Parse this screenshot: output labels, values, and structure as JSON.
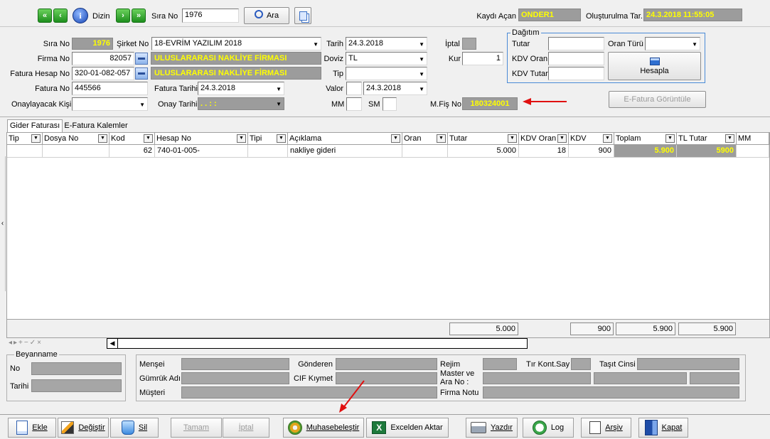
{
  "toolbar": {
    "nav_first": "«",
    "nav_prev": "‹",
    "info_label": "Dizin",
    "nav_next": "›",
    "nav_last": "»",
    "sira_label": "Sıra No",
    "sira_value": "1976",
    "search_label": "Ara",
    "kaydi_acan_label": "Kaydı Açan",
    "kaydi_acan_value": "ONDER1",
    "olusturma_label": "Oluşturulma Tar.",
    "olusturma_value": "24.3.2018 11:55:05"
  },
  "form": {
    "sira_no_label": "Sıra No",
    "sira_no_value": "1976",
    "sirket_label": "Şirket No",
    "sirket_value": "18-EVRİM YAZILIM 2018",
    "tarih_label": "Tarih",
    "tarih_value": "24.3.2018",
    "iptal_label": "İptal",
    "firma_label": "Firma No",
    "firma_value": "82057",
    "firma_name": "ULUSLARARASI NAKLİYE FİRMASI",
    "doviz_label": "Doviz",
    "doviz_value": "TL",
    "kur_label": "Kur",
    "kur_value": "1",
    "fatura_hesap_label": "Fatura Hesap No",
    "fatura_hesap_value": "320-01-082-057",
    "fatura_hesap_name": "ULUSLARARASI NAKLİYE FİRMASI",
    "tip_label": "Tip",
    "tip_value": "",
    "fatura_no_label": "Fatura No",
    "fatura_no_value": "445566",
    "fatura_tarihi_label": "Fatura Tarihi",
    "fatura_tarihi_value": "24.3.2018",
    "valor_label": "Valor",
    "valor_value": "24.3.2018",
    "onaylayacak_label": "Onaylayacak Kişi",
    "onay_tarihi_label": "Onay Tarihi",
    "onay_tarihi_value": ".   .        :   :",
    "mm_label": "MM",
    "sm_label": "SM",
    "mfis_label": "M.Fiş No",
    "mfis_value": "180324001"
  },
  "dagitim": {
    "title": "Dağıtım",
    "tutar_label": "Tutar",
    "oran_turu_label": "Oran Türü",
    "kdv_oran_label": "KDV Oran",
    "kdv_tutar_label": "KDV Tutar",
    "hesapla_label": "Hesapla",
    "efatura_btn": "E-Fatura Görüntüle"
  },
  "tabs": [
    "Gider Faturası",
    "E-Fatura Kalemler"
  ],
  "grid": {
    "columns": [
      "Tip",
      "Dosya No",
      "Kod",
      "Hesap No",
      "Tipi",
      "Açıklama",
      "Oran",
      "Tutar",
      "KDV Oran",
      "KDV",
      "Toplam",
      "TL Tutar",
      "MM"
    ],
    "row": {
      "tip": "",
      "dosya_no": "",
      "kod": "62",
      "hesap_no": "740-01-005-",
      "tipi": "",
      "aciklama": "nakliye gideri",
      "oran": "",
      "tutar": "5.000",
      "kdv_oran": "18",
      "kdv": "900",
      "toplam": "5.900",
      "tl_tutar": "5900"
    },
    "totals": {
      "tutar": "5.000",
      "kdv": "900",
      "toplam": "5.900",
      "tl_tutar": "5.900"
    }
  },
  "beyanname": {
    "title": "Beyanname",
    "no_label": "No",
    "tarihi_label": "Tarihi"
  },
  "detail": {
    "mensei_label": "Menşei",
    "gonderen_label": "Gönderen",
    "rejim_label": "Rejim",
    "tir_label": "Tır Kont.Say",
    "tasit_label": "Taşıt Cinsi",
    "gumruk_label": "Gümrük Adı",
    "cif_label": "CIF Kıymet",
    "master_label": "Master ve",
    "ara_no_label": "Ara No :",
    "musteri_label": "Müşteri",
    "firma_notu_label": "Firma Notu"
  },
  "buttons": {
    "ekle": "Ekle",
    "degistir": "Değiştir",
    "sil": "Sil",
    "tamam": "Tamam",
    "iptal": "İptal",
    "muhasebelestir": "Muhasebeleştir",
    "excelden_aktar": "Excelden Aktar",
    "yazdir": "Yazdır",
    "log": "Log",
    "arsiv": "Arşiv",
    "kapat": "Kapat"
  },
  "colors": {
    "readonly_bg": "#9c9c9c",
    "readonly_text": "#ffff00",
    "arrow": "#e01010"
  }
}
